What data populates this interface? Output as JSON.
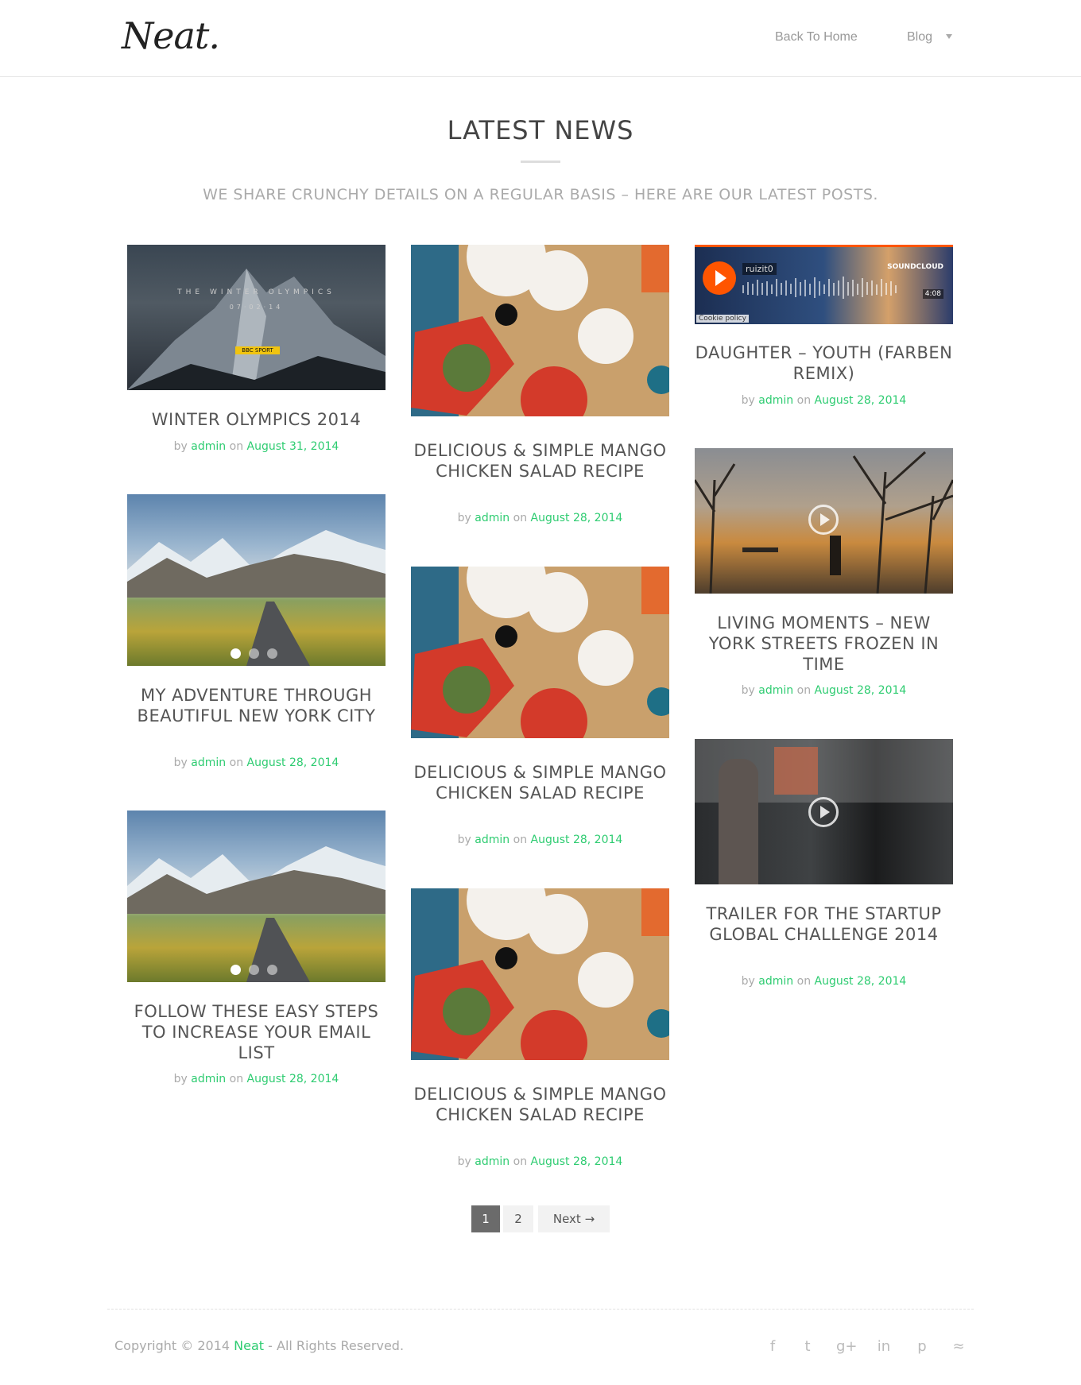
{
  "header": {
    "logo": "Neat.",
    "nav": {
      "home": "Back To Home",
      "blog": "Blog"
    }
  },
  "section": {
    "title": "LATEST NEWS",
    "subtitle": "WE SHARE CRUNCHY DETAILS ON A REGULAR BASIS – HERE ARE OUR LATEST POSTS."
  },
  "posts": [
    {
      "title": "WINTER OLYMPICS 2014",
      "by": "by ",
      "author": "admin",
      "on": " on ",
      "date": "August 31, 2014",
      "thumb_text": {
        "headline": "THE WINTER OLYMPICS",
        "date": "07·02·14",
        "badge": "BBC SPORT"
      }
    },
    {
      "title": "DELICIOUS & SIMPLE MANGO CHICKEN SALAD RECIPE",
      "by": "by ",
      "author": "admin",
      "on": " on ",
      "date": "August 28, 2014"
    },
    {
      "title": "DAUGHTER – YOUTH (FARBEN REMIX)",
      "by": "by ",
      "author": "admin",
      "on": " on ",
      "date": "August 28, 2014",
      "player": {
        "user": "ruizit0",
        "brand": "SOUNDCLOUD",
        "duration": "4:08",
        "cookie": "Cookie policy"
      }
    },
    {
      "title": "MY ADVENTURE THROUGH BEAUTIFUL NEW YORK CITY",
      "by": "by ",
      "author": "admin",
      "on": " on ",
      "date": "August 28, 2014"
    },
    {
      "title": "DELICIOUS & SIMPLE MANGO CHICKEN SALAD RECIPE",
      "by": "by ",
      "author": "admin",
      "on": " on ",
      "date": "August 28, 2014"
    },
    {
      "title": "LIVING MOMENTS – NEW YORK STREETS FROZEN IN TIME",
      "by": "by ",
      "author": "admin",
      "on": " on ",
      "date": "August 28, 2014"
    },
    {
      "title": "FOLLOW THESE EASY STEPS TO INCREASE YOUR EMAIL LIST",
      "by": "by ",
      "author": "admin",
      "on": " on ",
      "date": "August 28, 2014"
    },
    {
      "title": "DELICIOUS & SIMPLE MANGO CHICKEN SALAD RECIPE",
      "by": "by ",
      "author": "admin",
      "on": " on ",
      "date": "August 28, 2014"
    },
    {
      "title": "TRAILER FOR THE STARTUP GLOBAL CHALLENGE 2014",
      "by": "by ",
      "author": "admin",
      "on": " on ",
      "date": "August 28, 2014"
    }
  ],
  "pagination": {
    "page1": "1",
    "page2": "2",
    "next": "Next →",
    "current": 1
  },
  "footer": {
    "copy_pre": "Copyright © 2014 ",
    "brand": "Neat",
    "copy_post": " - All Rights Reserved.",
    "social": [
      "facebook-icon",
      "twitter-icon",
      "google-plus-icon",
      "linkedin-icon",
      "pinterest-icon",
      "rss-icon"
    ],
    "social_glyphs": {
      "facebook": "f",
      "twitter": "t",
      "google_plus": "g+",
      "linkedin": "in",
      "pinterest": "p",
      "rss": "≈"
    }
  },
  "colors": {
    "accent": "#2ecc71",
    "soundcloud": "#ff5500",
    "pager_active": "#6b6b6b"
  }
}
